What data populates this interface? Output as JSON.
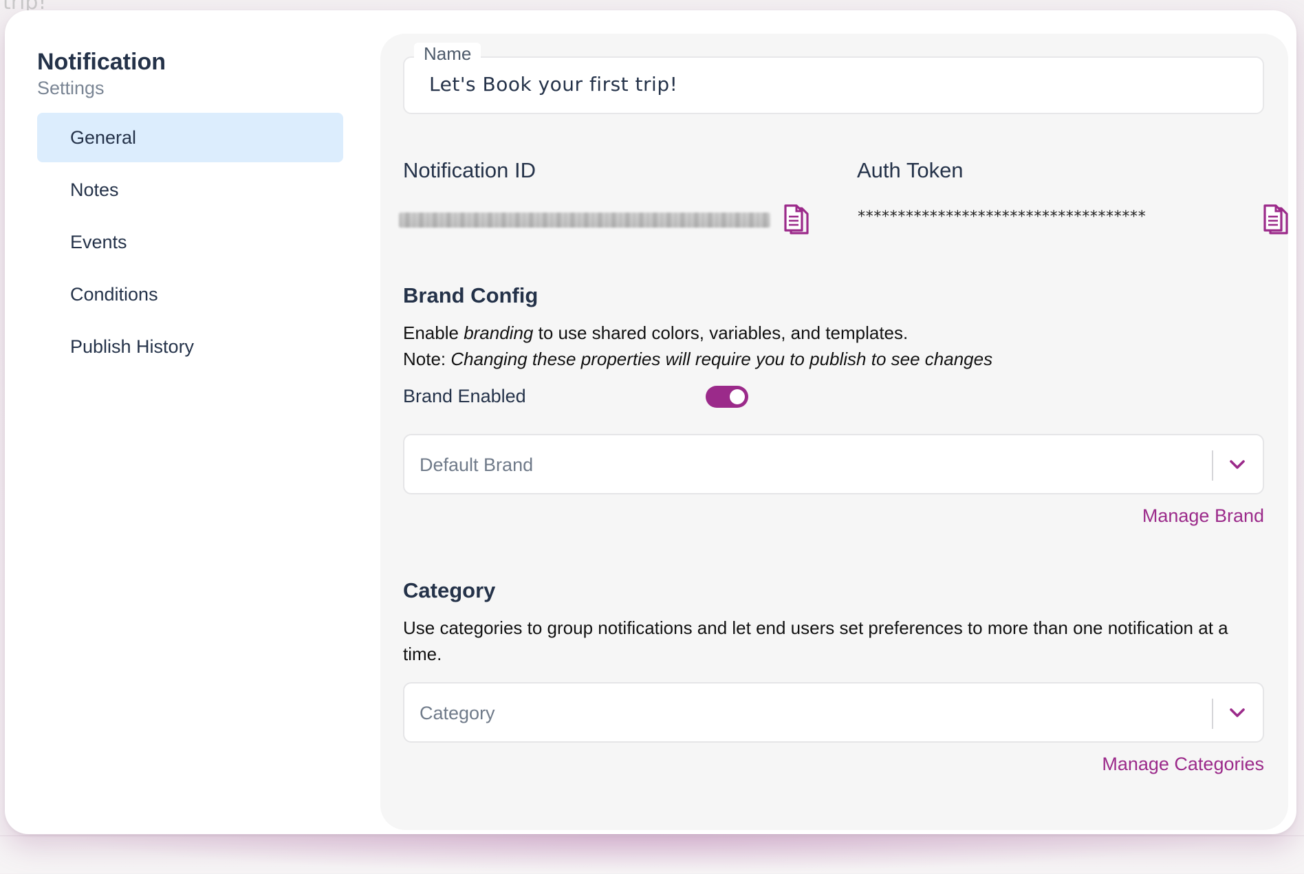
{
  "sidebar": {
    "title": "Notification",
    "subtitle": "Settings",
    "items": [
      {
        "label": "General",
        "active": true
      },
      {
        "label": "Notes",
        "active": false
      },
      {
        "label": "Events",
        "active": false
      },
      {
        "label": "Conditions",
        "active": false
      },
      {
        "label": "Publish History",
        "active": false
      }
    ]
  },
  "general": {
    "name_label": "Name",
    "name_value": "Let's Book your first trip!",
    "notification_id_label": "Notification ID",
    "auth_token_label": "Auth Token",
    "auth_token_value": "************************************",
    "brand": {
      "heading": "Brand Config",
      "desc_line1_pre": "Enable ",
      "desc_line1_em": "branding",
      "desc_line1_post": " to use shared colors, variables, and templates.",
      "desc_line2_pre": "Note: ",
      "desc_line2_em": "Changing these properties will require you to publish to see changes",
      "toggle_label": "Brand Enabled",
      "toggle_on": true,
      "select_placeholder": "Default Brand",
      "manage_link": "Manage Brand"
    },
    "category": {
      "heading": "Category",
      "desc": "Use categories to group notifications and let end users set preferences to more than one notification at a time.",
      "select_placeholder": "Category",
      "manage_link": "Manage Categories"
    }
  },
  "background": {
    "partial_text": "trip!"
  },
  "colors": {
    "accent": "#9b2a8a",
    "active_nav_bg": "#dcedfd",
    "heading_text": "#243249",
    "panel_bg": "#f6f6f6"
  },
  "icons": {
    "copy": "copy-document-icon",
    "chevron": "chevron-down-icon"
  }
}
